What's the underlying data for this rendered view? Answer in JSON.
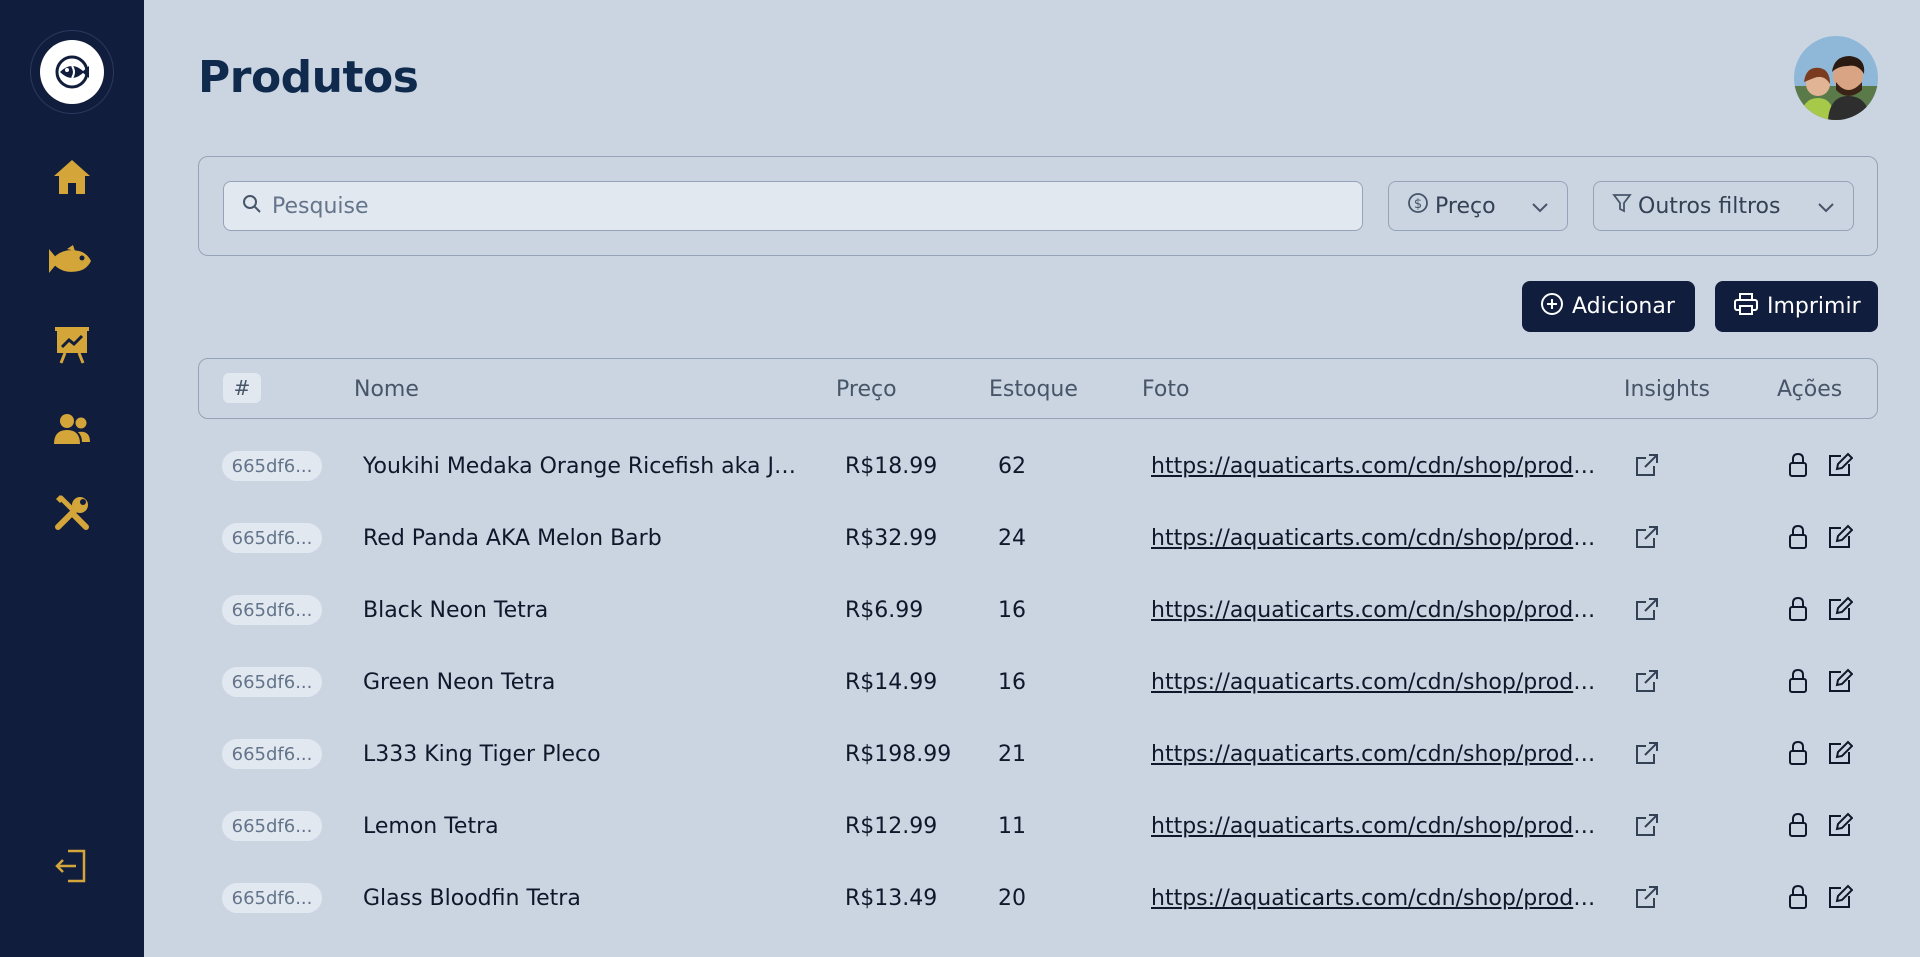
{
  "page": {
    "title": "Produtos"
  },
  "colors": {
    "sidebar": "#111d3c",
    "accent": "#d4a63a",
    "background": "#cbd5e1",
    "button": "#111d3c",
    "title": "#0f2a4d"
  },
  "sidebar": {
    "logo": "fish-logo-icon",
    "items": [
      {
        "icon": "home-icon"
      },
      {
        "icon": "fish-icon"
      },
      {
        "icon": "chart-board-icon"
      },
      {
        "icon": "users-icon"
      },
      {
        "icon": "tools-icon"
      }
    ],
    "logout_icon": "logout-icon"
  },
  "filters": {
    "search_placeholder": "Pesquise",
    "price_label": "Preço",
    "other_filters_label": "Outros filtros"
  },
  "actions": {
    "add_label": "Adicionar",
    "print_label": "Imprimir"
  },
  "table": {
    "columns": {
      "hash": "#",
      "name": "Nome",
      "price": "Preço",
      "stock": "Estoque",
      "photo": "Foto",
      "insights": "Insights",
      "actions": "Ações"
    },
    "rows": [
      {
        "id": "665df6...",
        "name": "Youkihi Medaka Orange Ricefish aka Jap...",
        "price": "R$18.99",
        "stock": "62",
        "photo": "https://aquaticarts.com/cdn/shop/produ..."
      },
      {
        "id": "665df6...",
        "name": "Red Panda AKA Melon Barb",
        "price": "R$32.99",
        "stock": "24",
        "photo": "https://aquaticarts.com/cdn/shop/produ..."
      },
      {
        "id": "665df6...",
        "name": "Black Neon Tetra",
        "price": "R$6.99",
        "stock": "16",
        "photo": "https://aquaticarts.com/cdn/shop/produ..."
      },
      {
        "id": "665df6...",
        "name": "Green Neon Tetra",
        "price": "R$14.99",
        "stock": "16",
        "photo": "https://aquaticarts.com/cdn/shop/produ..."
      },
      {
        "id": "665df6...",
        "name": "L333 King Tiger Pleco",
        "price": "R$198.99",
        "stock": "21",
        "photo": "https://aquaticarts.com/cdn/shop/produ..."
      },
      {
        "id": "665df6...",
        "name": "Lemon Tetra",
        "price": "R$12.99",
        "stock": "11",
        "photo": "https://aquaticarts.com/cdn/shop/produ..."
      },
      {
        "id": "665df6...",
        "name": "Glass Bloodfin Tetra",
        "price": "R$13.49",
        "stock": "20",
        "photo": "https://aquaticarts.com/cdn/shop/produ..."
      }
    ]
  }
}
